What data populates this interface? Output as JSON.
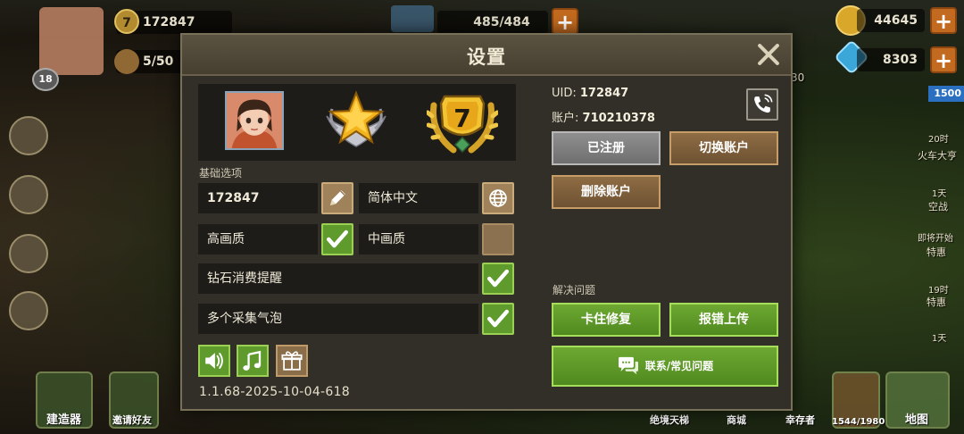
{
  "hud": {
    "player_power": "172847",
    "player_level_badge": "7",
    "player_level": "18",
    "population": "5/50",
    "energy": "485/484",
    "gold": "44645",
    "diamonds": "8303",
    "badge_value": "1500",
    "timer_20h": "20时",
    "train_label": "火车大亨",
    "day_1a": "1天",
    "airport_label": "空战",
    "start_label": "即将开始",
    "special_a": "特惠",
    "timer_19h": "19时",
    "special_b": "特惠",
    "day_1b": "1天",
    "bottom_builder": "建造器",
    "bottom_invite": "邀请好友",
    "bottom_tower": "绝境天梯",
    "bottom_shop": "商城",
    "bottom_survivor": "幸存者",
    "bottom_capacity": "1544/1980",
    "bottom_map": "地图",
    "timer_30": "30"
  },
  "dialog": {
    "title": "设置",
    "basic_options_label": "基础选项",
    "name_value": "172847",
    "language_value": "简体中文",
    "quality_high": "高画质",
    "quality_mid": "中画质",
    "diamond_reminder": "钻石消费提醒",
    "multi_bubble": "多个采集气泡",
    "version": "1.1.68-2025-10-04-618",
    "rank_level": "7",
    "uid_label": "UID:",
    "uid_value": "172847",
    "account_label": "账户:",
    "account_value": "710210378",
    "registered_button": "已注册",
    "switch_account_button": "切换账户",
    "delete_account_button": "删除账户",
    "solve_problems_label": "解决问题",
    "stuck_fix_button": "卡住修复",
    "report_bug_button": "报错上传",
    "contact_faq_button": "联系/常见问题"
  },
  "settings_state": {
    "high_quality_checked": true,
    "mid_quality_checked": false,
    "diamond_reminder_checked": true,
    "multi_bubble_checked": true
  },
  "colors": {
    "panel": "#322f29",
    "green_button": "#5e9a2c",
    "brown_button": "#8e6c44",
    "gray_button": "#7f7f7f"
  },
  "icons": [
    "pencil-icon",
    "globe-icon",
    "checkmark-icon",
    "speaker-icon",
    "music-note-icon",
    "gift-icon",
    "phone-support-icon",
    "chat-bubble-icon",
    "close-icon",
    "star-rank-icon",
    "laurel-level-icon"
  ]
}
